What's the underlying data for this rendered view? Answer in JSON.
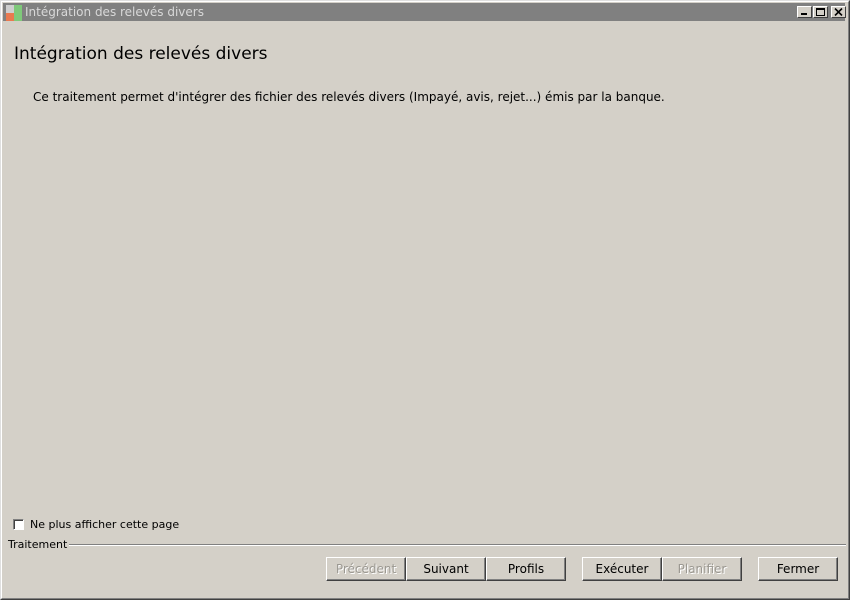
{
  "window": {
    "title": "Intégration des relevés divers"
  },
  "main": {
    "heading": "Intégration des relevés divers",
    "description": "Ce traitement permet d'intégrer des fichier des relevés divers (Impayé, avis, rejet...) émis par la banque."
  },
  "options": {
    "hide_page_label": "Ne plus afficher cette page",
    "hide_page_checked": false
  },
  "footer": {
    "group_label": "Traitement",
    "buttons": {
      "previous": "Précédent",
      "next": "Suivant",
      "profiles": "Profils",
      "execute": "Exécuter",
      "schedule": "Planifier",
      "close": "Fermer"
    }
  },
  "icons": {
    "app": "app-logo-icon",
    "minimize": "minimize-icon",
    "maximize": "maximize-icon",
    "close": "close-icon"
  },
  "colors": {
    "face": "#d4d0c8",
    "titlebar_inactive": "#808080",
    "disabled_text": "#9b9891"
  }
}
